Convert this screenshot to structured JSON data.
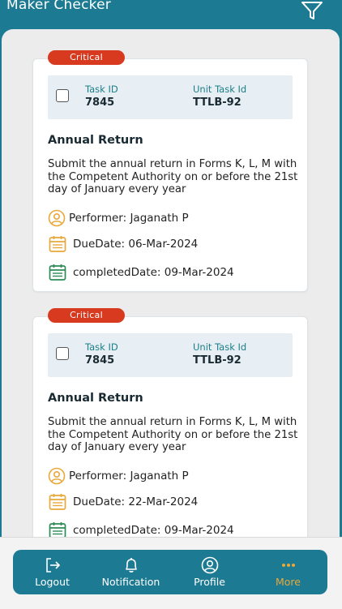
{
  "header": {
    "title": "Maker Checker",
    "filter_icon": "filter-icon"
  },
  "tasks": [
    {
      "priority": "Critical",
      "task_id_label": "Task ID",
      "task_id": "7845",
      "unit_task_id_label": "Unit Task Id",
      "unit_task_id": "TTLB-92",
      "title": "Annual Return",
      "description": "Submit the annual return in Forms K, L, M with the Competent Authority on or before the 21st day of January every year",
      "performer": "Performer: Jaganath P",
      "due_date": "DueDate: 06-Mar-2024",
      "completed_date": "completedDate: 09-Mar-2024"
    },
    {
      "priority": "Critical",
      "task_id_label": "Task ID",
      "task_id": "7845",
      "unit_task_id_label": "Unit Task Id",
      "unit_task_id": "TTLB-92",
      "title": "Annual Return",
      "description": "Submit the annual return in Forms K, L, M with the Competent Authority on or before the 21st day of January every year",
      "performer": "Performer: Jaganath P",
      "due_date": "DueDate: 22-Mar-2024",
      "completed_date": "completedDate: 09-Mar-2024"
    }
  ],
  "nav": {
    "items": [
      {
        "label": "Logout",
        "icon": "logout-icon"
      },
      {
        "label": "Notification",
        "icon": "bell-icon"
      },
      {
        "label": "Profile",
        "icon": "user-circle-icon"
      },
      {
        "label": "More",
        "icon": "more-dots-icon"
      }
    ],
    "active_color": "#e8a83a"
  },
  "colors": {
    "brand": "#1d7a93",
    "critical": "#d83a1f",
    "teal_label": "#1a7f87"
  }
}
